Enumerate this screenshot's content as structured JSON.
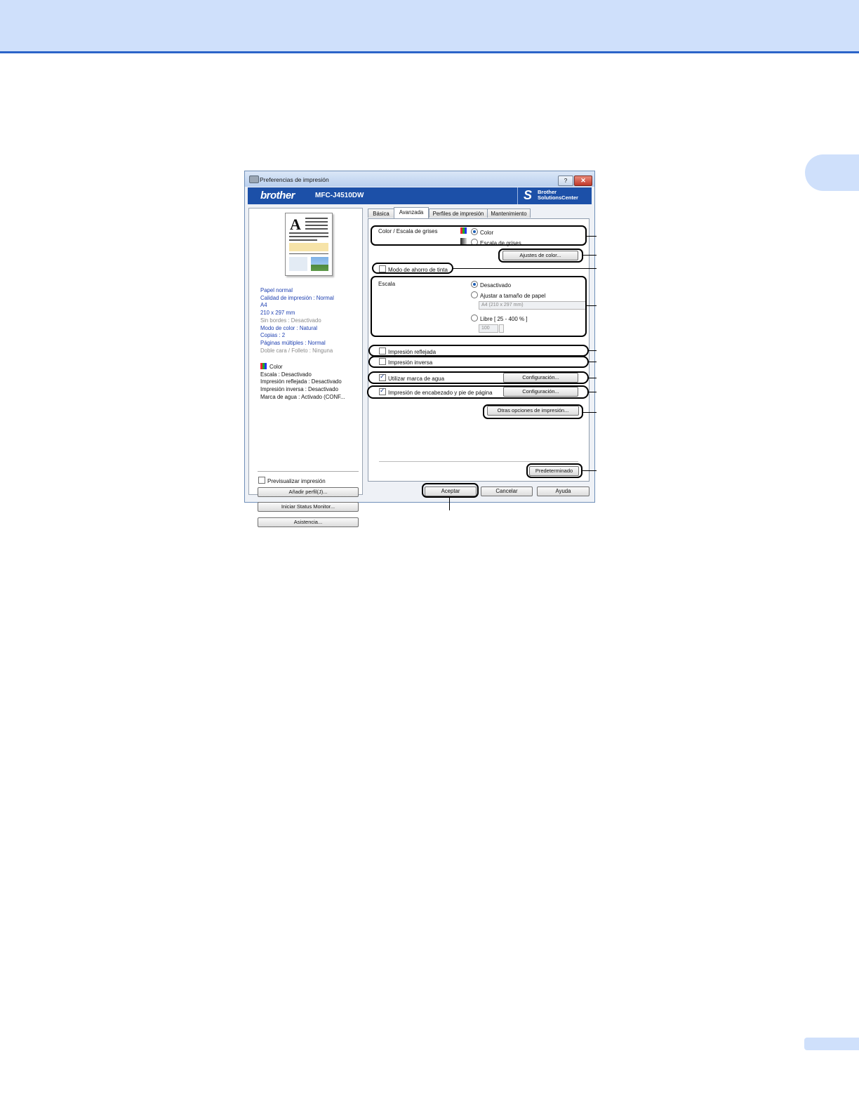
{
  "dialog": {
    "title": "Preferencias de impresión",
    "help_label": "?",
    "close_label": "✕",
    "brand": "brother",
    "model": "MFC-J4510DW",
    "solutions_s": "S",
    "solutions_line1": "Brother",
    "solutions_line2": "SolutionsCenter"
  },
  "summary": {
    "lines": [
      "Papel normal",
      "Calidad de impresión : Normal",
      "A4",
      "210 x 297 mm",
      "Sin bordes : Desactivado",
      "Modo de color : Natural",
      "Copias : 2",
      "Páginas múltiples : Normal",
      "Doble cara / Folleto : Ninguna"
    ],
    "lines2": [
      "Color",
      "Escala : Desactivado",
      "Impresión reflejada : Desactivado",
      "Impresión inversa : Desactivado",
      "Marca de agua : Activado (CONF..."
    ],
    "preview_label": "Previsualizar impresión",
    "add_profile": "Añadir perfil(J)...",
    "status_monitor": "Iniciar Status Monitor...",
    "support": "Asistencia..."
  },
  "tabs": [
    "Básica",
    "Avanzada",
    "Perfiles de impresión",
    "Mantenimiento"
  ],
  "advanced": {
    "color_group_label": "Color / Escala de grises",
    "color_option": "Color",
    "gray_option": "Escala de grises",
    "color_settings": "Ajustes de color...",
    "ink_save": "Modo de ahorro de tinta",
    "scale_label": "Escala",
    "scale_off": "Desactivado",
    "scale_fit": "Ajustar a tamaño de papel",
    "paper_size_value": "A4 (210 x 297 mm)",
    "scale_free": "Libre [ 25 - 400 % ]",
    "scale_value": "100",
    "mirror": "Impresión reflejada",
    "reverse": "Impresión inversa",
    "watermark": "Utilizar marca de agua",
    "watermark_settings": "Configuración...",
    "header_footer": "Impresión de encabezado y pie de página",
    "header_footer_settings": "Configuración...",
    "other_options": "Otras opciones de impresión...",
    "default": "Predeterminado"
  },
  "buttons": {
    "ok": "Aceptar",
    "cancel": "Cancelar",
    "help": "Ayuda"
  }
}
